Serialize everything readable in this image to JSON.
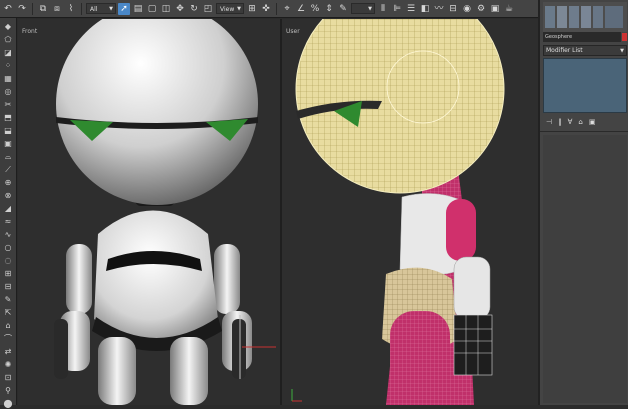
{
  "toolbar": {
    "filter_value": "All",
    "refcoord_value": "View"
  },
  "viewports": {
    "left_label": "Front",
    "right_label": "User"
  },
  "command_panel": {
    "object_name": "Geosphere",
    "modifier_list_label": "Modifier List"
  },
  "colors": {
    "ui_dark": "#2b2b2b",
    "active_tool": "#4a88c8",
    "stack_bg": "#4a6478",
    "selection_wire": "#f2e6a0",
    "magenta_mesh": "#c8346e"
  }
}
